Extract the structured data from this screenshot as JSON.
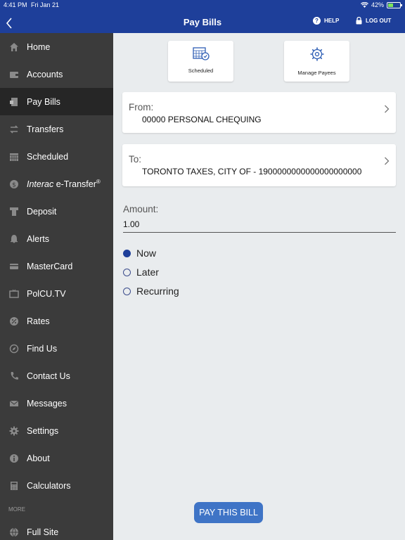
{
  "status": {
    "time": "4:41 PM",
    "date": "Fri Jan 21",
    "battery": "42%"
  },
  "header": {
    "title": "Pay Bills",
    "help": "HELP",
    "logout": "LOG OUT"
  },
  "sidebar": {
    "items": [
      {
        "label": "Home",
        "icon": "home-icon"
      },
      {
        "label": "Accounts",
        "icon": "wallet-icon"
      },
      {
        "label": "Pay Bills",
        "icon": "bill-icon"
      },
      {
        "label": "Transfers",
        "icon": "transfer-icon"
      },
      {
        "label": "Scheduled",
        "icon": "calendar-icon"
      },
      {
        "label_italic": "Interac",
        "label_rest": " e-Transfer",
        "label_sup": "®",
        "icon": "dollar-icon"
      },
      {
        "label": "Deposit",
        "icon": "deposit-icon"
      },
      {
        "label": "Alerts",
        "icon": "bell-icon"
      },
      {
        "label": "MasterCard",
        "icon": "card-icon"
      },
      {
        "label": "PolCU.TV",
        "icon": "tv-icon"
      },
      {
        "label": "Rates",
        "icon": "percent-icon"
      },
      {
        "label": "Find Us",
        "icon": "compass-icon"
      },
      {
        "label": "Contact Us",
        "icon": "phone-icon"
      },
      {
        "label": "Messages",
        "icon": "envelope-icon"
      },
      {
        "label": "Settings",
        "icon": "gear-icon"
      },
      {
        "label": "About",
        "icon": "info-icon"
      },
      {
        "label": "Calculators",
        "icon": "calculator-icon"
      }
    ],
    "more_label": "MORE",
    "full_site": {
      "label": "Full Site",
      "icon": "globe-icon"
    }
  },
  "quick": {
    "scheduled": "Scheduled",
    "manage_payees": "Manage Payees"
  },
  "from": {
    "label": "From:",
    "value": "00000 PERSONAL CHEQUING"
  },
  "to": {
    "label": "To:",
    "value": "TORONTO TAXES, CITY OF - 1900000000000000000000"
  },
  "amount": {
    "label": "Amount:",
    "value": "1.00"
  },
  "timing": {
    "options": [
      "Now",
      "Later",
      "Recurring"
    ],
    "selected": "Now"
  },
  "pay_button": "PAY THIS BILL",
  "colors": {
    "header": "#1e3f9a",
    "sidebar": "#3b3b3b",
    "button": "#3f74c6"
  }
}
